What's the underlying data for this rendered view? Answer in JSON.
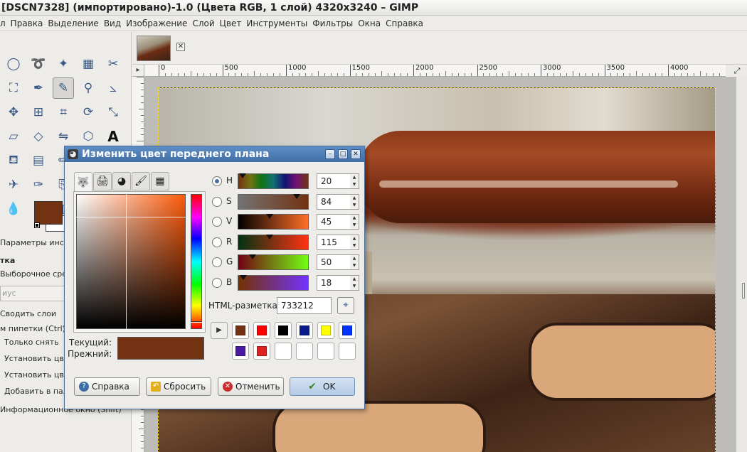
{
  "window": {
    "title": "[DSCN7328] (импортировано)-1.0 (Цвета RGB, 1 слой) 4320x3240 – GIMP"
  },
  "menu": [
    "л",
    "Правка",
    "Выделение",
    "Вид",
    "Изображение",
    "Слой",
    "Цвет",
    "Инструменты",
    "Фильтры",
    "Окна",
    "Справка"
  ],
  "tool_icons": [
    "ellipse-select-icon",
    "free-select-icon",
    "fuzzy-select-icon",
    "by-color-select-icon",
    "scissors-icon",
    "foreground-select-icon",
    "paths-icon",
    "color-picker-icon",
    "zoom-icon",
    "measure-icon",
    "move-icon",
    "align-icon",
    "crop-icon",
    "rotate-icon",
    "scale-icon",
    "shear-icon",
    "perspective-icon",
    "flip-icon",
    "cage-icon",
    "text-icon",
    "bucket-fill-icon",
    "blend-icon",
    "pencil-icon",
    "paintbrush-icon",
    "eraser-icon",
    "airbrush-icon",
    "ink-icon",
    "clone-icon",
    "heal-icon",
    "perspective-clone-icon",
    "blur-icon",
    "smudge-icon",
    "dodge-burn-icon"
  ],
  "toolbox": {
    "fg_color": "#733212",
    "bg_color": "#ffffff",
    "options_title": "Параметры инстру",
    "section": "тка",
    "sample_average": "Выборочное средн",
    "radius_placeholder": "иус",
    "sample_merged": "Сводить слои",
    "pick_mode": "м пипетки (Ctrl)",
    "mode_pick_only": "Только снять",
    "mode_set_fg": "Установить цвет",
    "mode_set_bg": "Установить цвет",
    "mode_add_palette": "Добавить в палит",
    "info_window": "Информационное окно (Shift)"
  },
  "image_tab": {
    "close_label": "✕"
  },
  "ruler": {
    "labels": [
      "0",
      "500",
      "1000",
      "1500",
      "2000",
      "2500",
      "3000",
      "3500",
      "4000"
    ]
  },
  "dialog": {
    "title": "Изменить цвет переднего плана",
    "selector_tabs": [
      "wilber-icon",
      "printer-icon",
      "color-wheel-icon",
      "brush-icon",
      "palette-icon"
    ],
    "channels": [
      {
        "label": "H",
        "value": "20",
        "fraction": 0.06,
        "selected": true,
        "gradient": "linear-gradient(to right,#733212 0%,#737312 17%,#127312 33%,#127373 50%,#121273 67%,#731273 83%,#733212 100%)"
      },
      {
        "label": "S",
        "value": "84",
        "fraction": 0.84,
        "selected": false,
        "gradient": "linear-gradient(to right,#737373,#733212)"
      },
      {
        "label": "V",
        "value": "45",
        "fraction": 0.45,
        "selected": false,
        "gradient": "linear-gradient(to right,#000000,#ff6f28)"
      },
      {
        "label": "R",
        "value": "115",
        "fraction": 0.45,
        "selected": false,
        "gradient": "linear-gradient(to right,#003212,#ff3212)"
      },
      {
        "label": "G",
        "value": "50",
        "fraction": 0.2,
        "selected": false,
        "gradient": "linear-gradient(to right,#730012,#73ff12)"
      },
      {
        "label": "B",
        "value": "18",
        "fraction": 0.07,
        "selected": false,
        "gradient": "linear-gradient(to right,#733200,#7332ff)"
      }
    ],
    "html_label": "HTML-разметка:",
    "html_value": "733212",
    "current_label": "Текущий:",
    "previous_label": "Прежний:",
    "current_color": "#733212",
    "history_colors": [
      "#733212",
      "#ff0000",
      "#000000",
      "#0a1a8a",
      "#ffff00",
      "#0033ff",
      "#4a1aa0",
      "#dd2222",
      "#ffffff",
      "#ffffff",
      "#ffffff",
      "#ffffff"
    ],
    "buttons": {
      "help": "Справка",
      "reset": "Сбросить",
      "cancel": "Отменить",
      "ok": "OK"
    }
  }
}
